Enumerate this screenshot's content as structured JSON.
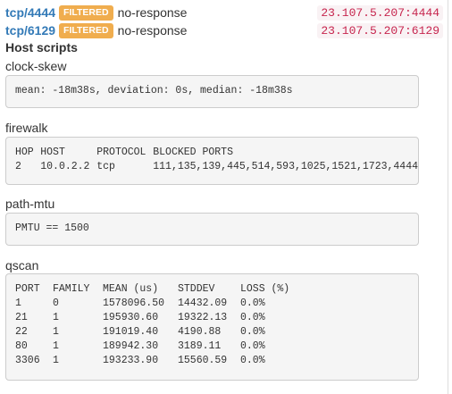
{
  "ports": [
    {
      "port": "tcp/4444",
      "state": "FILTERED",
      "reason": "no-response",
      "address": "23.107.5.207:4444"
    },
    {
      "port": "tcp/6129",
      "state": "FILTERED",
      "reason": "no-response",
      "address": "23.107.5.207:6129"
    }
  ],
  "host_scripts_title": "Host scripts",
  "scripts": {
    "clock_skew": {
      "name": "clock-skew",
      "output": "mean: -18m38s, deviation: 0s, median: -18m38s"
    },
    "firewalk": {
      "name": "firewalk",
      "headers": [
        "HOP",
        "HOST",
        "PROTOCOL",
        "BLOCKED PORTS"
      ],
      "rows": [
        [
          "2",
          "10.0.2.2",
          "tcp",
          "111,135,139,445,514,593,1025,1521,1723,4444"
        ]
      ]
    },
    "path_mtu": {
      "name": "path-mtu",
      "output": "PMTU == 1500"
    },
    "qscan": {
      "name": "qscan",
      "headers": [
        "PORT",
        "FAMILY",
        "MEAN (us)",
        "STDDEV",
        "LOSS (%)"
      ],
      "rows": [
        [
          "1",
          "0",
          "1578096.50",
          "14432.09",
          "0.0%"
        ],
        [
          "21",
          "1",
          "195930.60",
          "19322.13",
          "0.0%"
        ],
        [
          "22",
          "1",
          "191019.40",
          "4190.88",
          "0.0%"
        ],
        [
          "80",
          "1",
          "189942.30",
          "3189.11",
          "0.0%"
        ],
        [
          "3306",
          "1",
          "193233.90",
          "15560.59",
          "0.0%"
        ]
      ]
    }
  }
}
